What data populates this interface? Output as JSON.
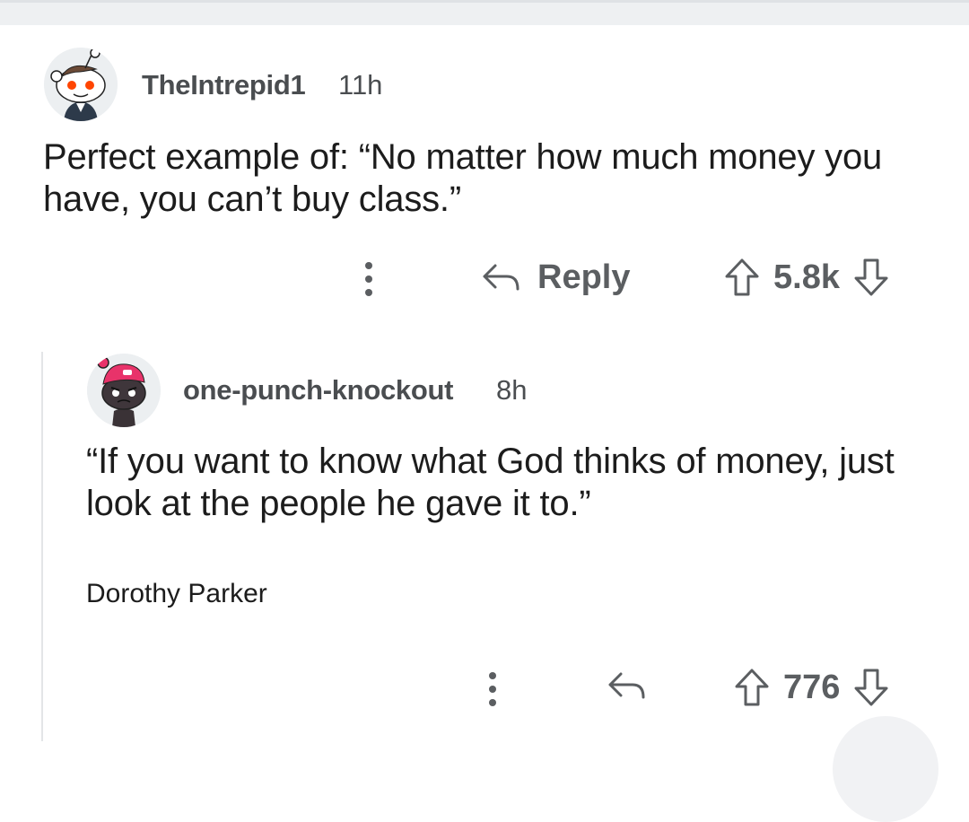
{
  "comments": [
    {
      "username": "TheIntrepid1",
      "timestamp": "11h",
      "body": "Perfect example of: “No matter how much money you have, you can’t buy class.”",
      "actions": {
        "reply_label": "Reply",
        "score": "5.8k"
      }
    },
    {
      "username": "one-punch-knockout",
      "timestamp": "8h",
      "body": "“If you want to know what God thinks of money, just look at the people he gave it to.”",
      "signature": "Dorothy Parker",
      "actions": {
        "score": "776"
      }
    }
  ],
  "icons": {
    "more": "kebab-vertical",
    "reply": "reply-arrow",
    "upvote": "arrow-up-outline",
    "downvote": "arrow-down-outline"
  },
  "colors": {
    "text": "#1c1c1c",
    "muted": "#5b5e61",
    "username": "#4a4d50",
    "thread_line": "#e3e5e7",
    "beanie": "#e8336a"
  }
}
